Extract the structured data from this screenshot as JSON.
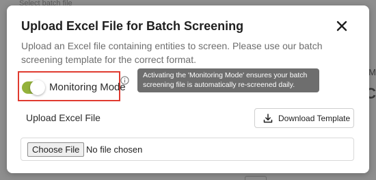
{
  "backdrop": {
    "top_text": "Select batch file",
    "right_letter_1": "M",
    "right_letter_2": "C"
  },
  "modal": {
    "title": "Upload Excel File for Batch Screening",
    "close_icon": "close-icon",
    "description": "Upload an Excel file containing entities to screen. Please use our batch screening template for the correct format."
  },
  "monitoring": {
    "label": "Monitoring Mode",
    "enabled": true,
    "toggle_color": "#93b23b",
    "highlight_color": "#e03a2f",
    "info_icon": "info-icon",
    "tooltip": "Activating the 'Monitoring Mode' ensures your batch screening file is automatically re-screened daily."
  },
  "upload": {
    "label": "Upload Excel File",
    "download_label": "Download Template",
    "download_icon": "download-icon",
    "choose_label": "Choose File",
    "file_status": "No file chosen"
  }
}
